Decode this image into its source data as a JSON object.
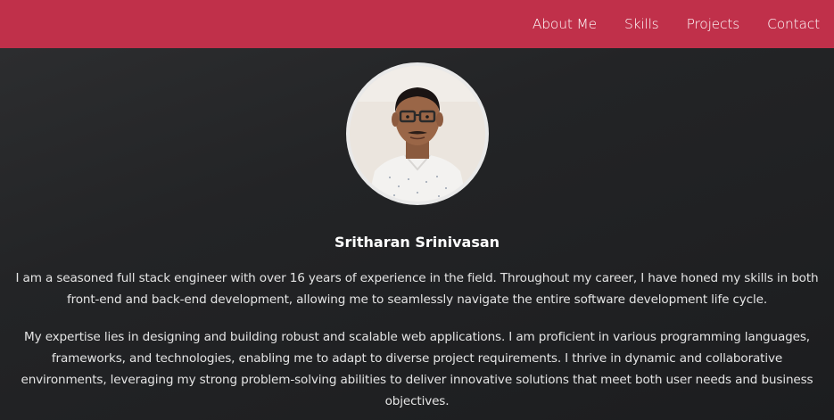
{
  "nav": {
    "items": [
      "About Me",
      "Skills",
      "Projects",
      "Contact"
    ]
  },
  "profile": {
    "name": "Sritharan Srinivasan",
    "bio": [
      "I am a seasoned full stack engineer with over 16 years of experience in the field. Throughout my career, I have honed my skills in both front-end and back-end development, allowing me to seamlessly navigate the entire software development life cycle.",
      "My expertise lies in designing and building robust and scalable web applications. I am proficient in various programming languages, frameworks, and technologies, enabling me to adapt to diverse project requirements. I thrive in dynamic and collaborative environments, leveraging my strong problem-solving abilities to deliver innovative solutions that meet both user needs and business objectives."
    ]
  },
  "colors": {
    "navbar": "#c0304a",
    "background": "#232426",
    "text": "#e4e4e4"
  }
}
